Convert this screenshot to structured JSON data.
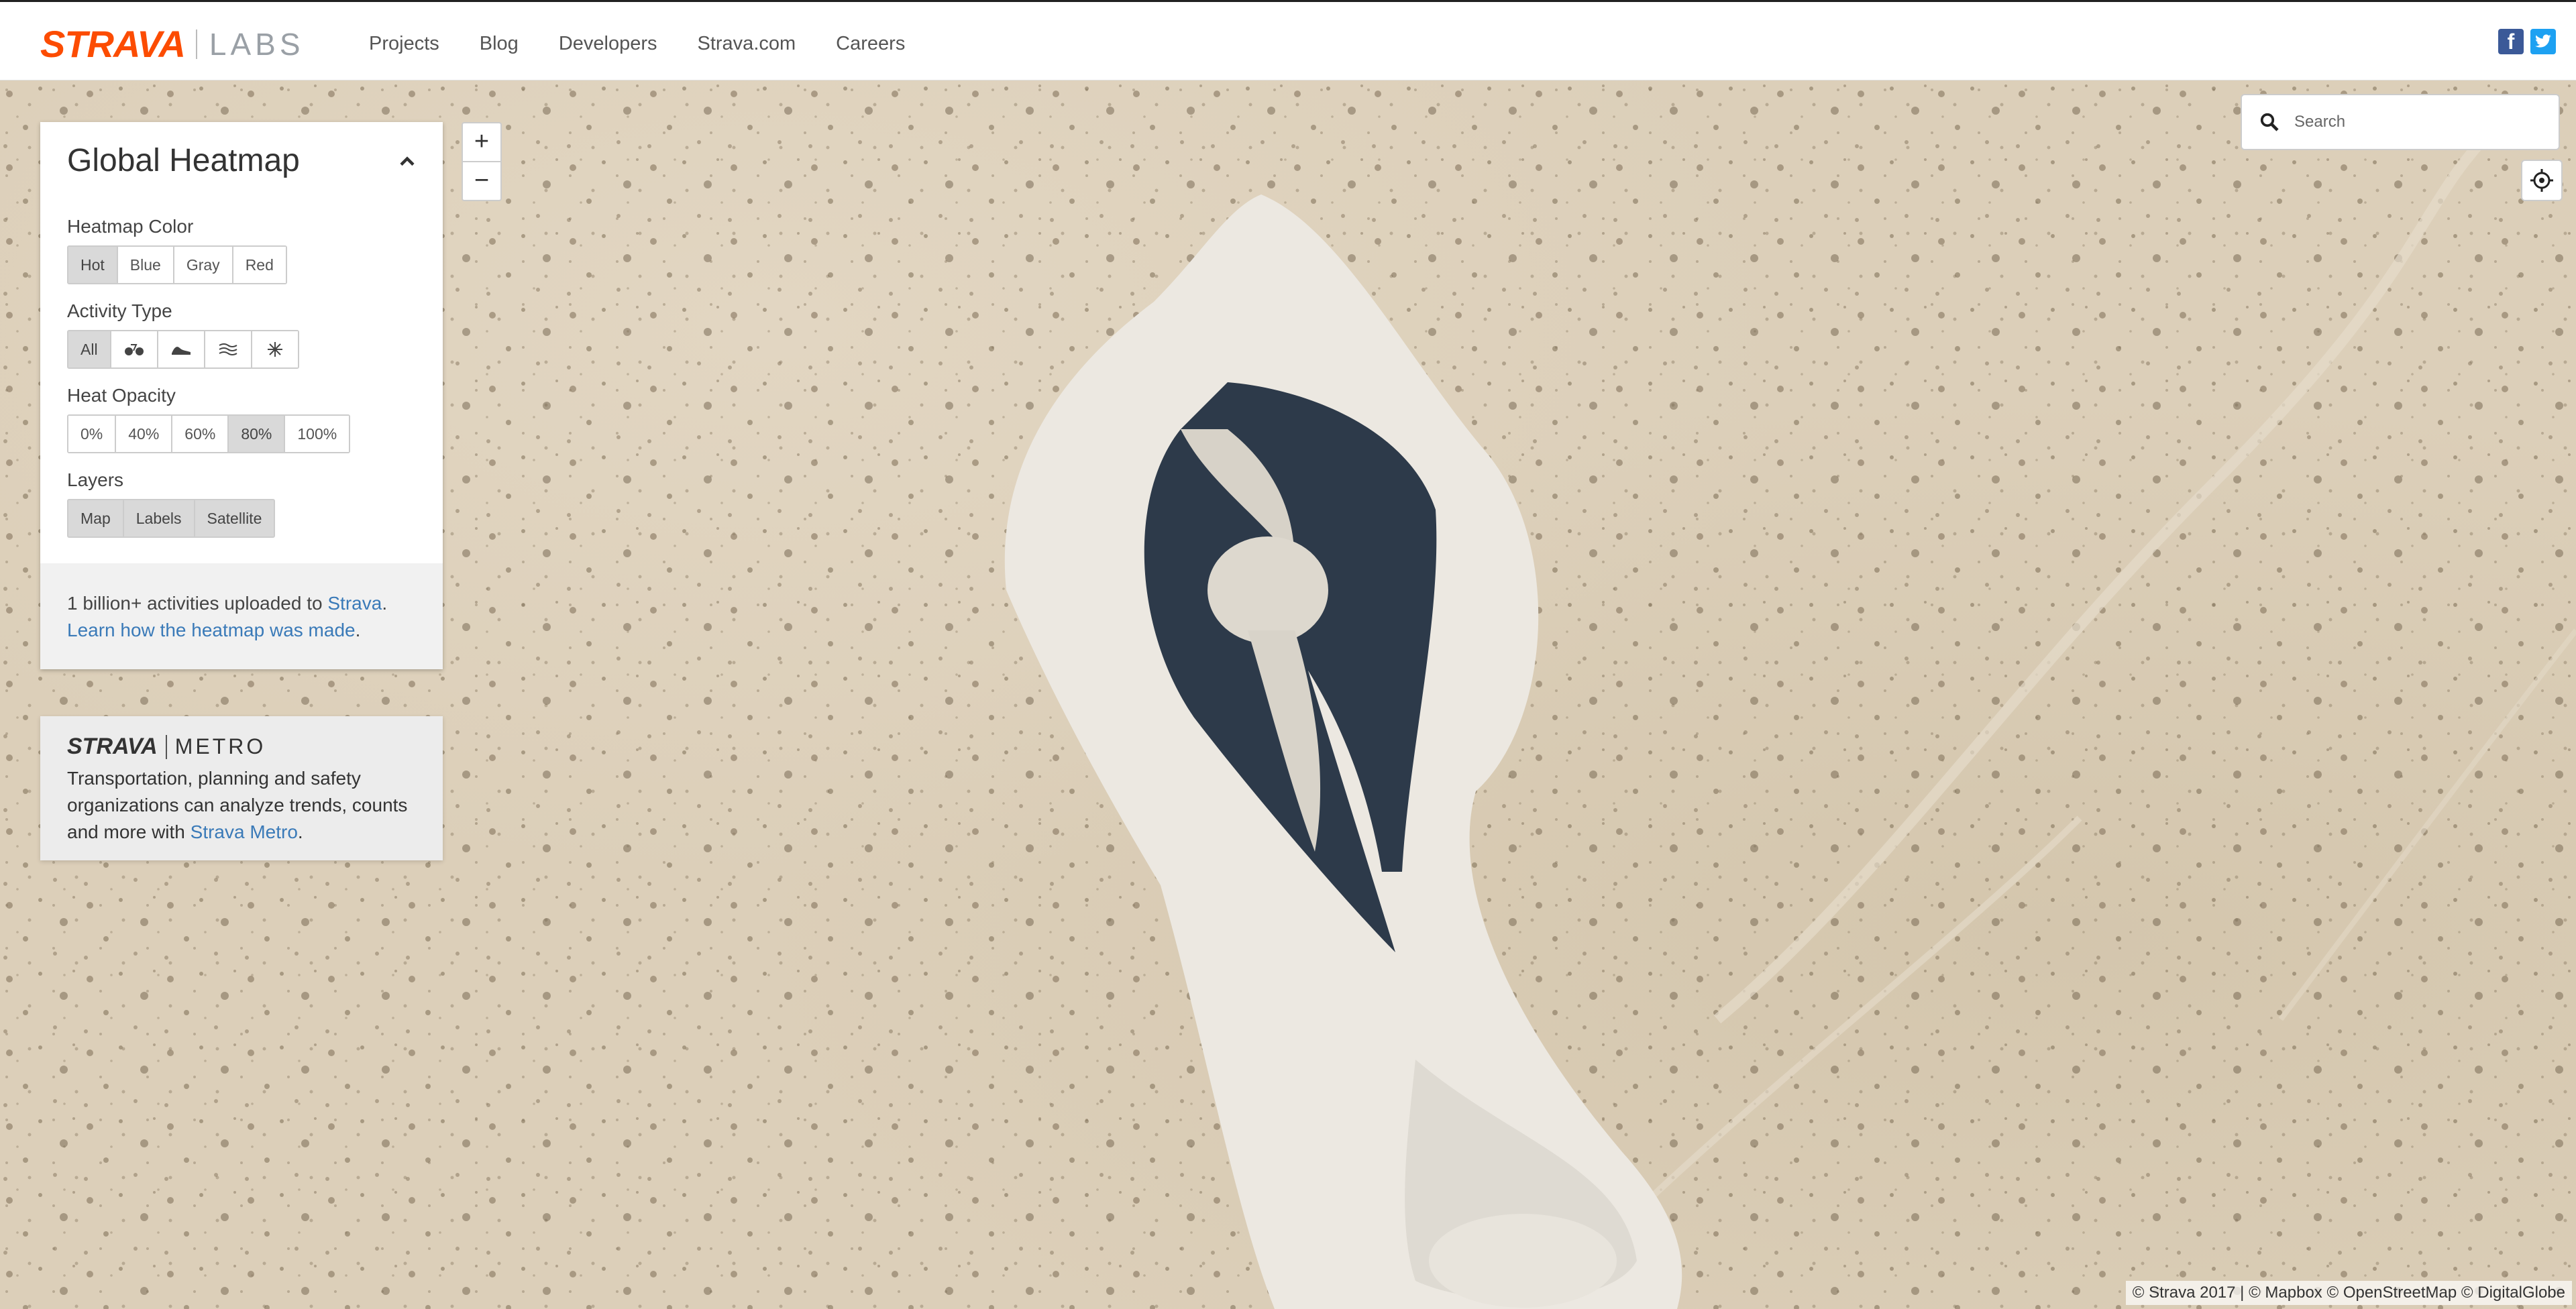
{
  "header": {
    "logo_text": "STRAVA",
    "logo_sub": "LABS",
    "nav": [
      "Projects",
      "Blog",
      "Developers",
      "Strava.com",
      "Careers"
    ],
    "social": [
      {
        "icon": "facebook-icon",
        "glyph": "f"
      },
      {
        "icon": "twitter-icon",
        "glyph": "t"
      }
    ]
  },
  "panel": {
    "title": "Global Heatmap",
    "heatmap_color": {
      "label": "Heatmap Color",
      "options": [
        "Hot",
        "Blue",
        "Gray",
        "Red"
      ],
      "selected": "Hot"
    },
    "activity_type": {
      "label": "Activity Type",
      "all_label": "All",
      "icons": [
        "bike-icon",
        "run-icon",
        "water-icon",
        "winter-icon"
      ],
      "selected": "All"
    },
    "heat_opacity": {
      "label": "Heat Opacity",
      "options": [
        "0%",
        "40%",
        "60%",
        "80%",
        "100%"
      ],
      "selected": "80%"
    },
    "layers": {
      "label": "Layers",
      "options": [
        "Map",
        "Labels",
        "Satellite"
      ]
    },
    "info": {
      "text_before": "1 billion+ activities uploaded to ",
      "strava_link": "Strava",
      "text_after": ".",
      "learn_link": "Learn how the heatmap was made",
      "learn_after": "."
    }
  },
  "metro": {
    "logo_strava": "STRAVA",
    "logo_metro": "METRO",
    "text": "Transportation, planning and safety organizations can analyze trends, counts and more with ",
    "link": "Strava Metro",
    "after": "."
  },
  "map_controls": {
    "zoom_in": "+",
    "zoom_out": "−",
    "search_placeholder": "Search",
    "search_value": ""
  },
  "attribution": "© Strava 2017 | © Mapbox © OpenStreetMap © DigitalGlobe",
  "colors": {
    "brand": "#fc4c02",
    "link": "#3a7ab8",
    "sand": "#dccfb9"
  }
}
